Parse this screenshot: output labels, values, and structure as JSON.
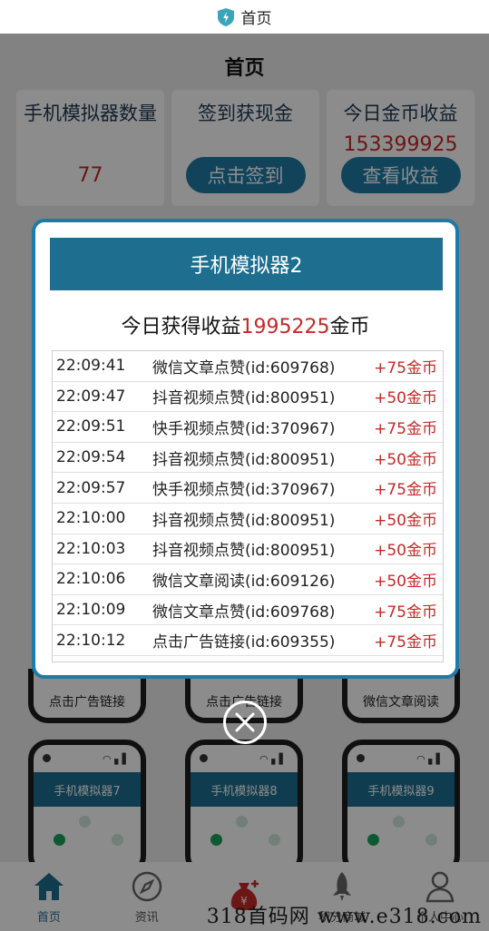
{
  "topbar": {
    "title": "首页"
  },
  "page": {
    "title": "首页"
  },
  "stats": {
    "devices": {
      "label": "手机模拟器数量",
      "value": "77"
    },
    "signin": {
      "label": "签到获现金",
      "button": "点击签到"
    },
    "income": {
      "label": "今日金币收益",
      "value": "153399925",
      "button": "查看收益"
    }
  },
  "bg_cards": {
    "row1": [
      "点击广告链接",
      "点击广告链接",
      "微信文章阅读"
    ],
    "row2": [
      "手机模拟器7",
      "手机模拟器8",
      "手机模拟器9"
    ]
  },
  "modal": {
    "title": "手机模拟器2",
    "summary_prefix": "今日获得收益",
    "summary_amount": "1995225",
    "summary_suffix": "金币",
    "log": [
      {
        "time": "22:09:41",
        "desc": "微信文章点赞(id:609768)",
        "reward": "+75金币"
      },
      {
        "time": "22:09:47",
        "desc": "抖音视频点赞(id:800951)",
        "reward": "+50金币"
      },
      {
        "time": "22:09:51",
        "desc": "快手视频点赞(id:370967)",
        "reward": "+75金币"
      },
      {
        "time": "22:09:54",
        "desc": "抖音视频点赞(id:800951)",
        "reward": "+50金币"
      },
      {
        "time": "22:09:57",
        "desc": "快手视频点赞(id:370967)",
        "reward": "+75金币"
      },
      {
        "time": "22:10:00",
        "desc": "抖音视频点赞(id:800951)",
        "reward": "+50金币"
      },
      {
        "time": "22:10:03",
        "desc": "抖音视频点赞(id:800951)",
        "reward": "+50金币"
      },
      {
        "time": "22:10:06",
        "desc": "微信文章阅读(id:609126)",
        "reward": "+50金币"
      },
      {
        "time": "22:10:09",
        "desc": "微信文章点赞(id:609768)",
        "reward": "+75金币"
      },
      {
        "time": "22:10:12",
        "desc": "点击广告链接(id:609355)",
        "reward": "+75金币"
      }
    ]
  },
  "nav": {
    "items": [
      {
        "label": "首页",
        "icon": "home-icon"
      },
      {
        "label": "资讯",
        "icon": "compass-icon"
      },
      {
        "label": "",
        "icon": "money-bag-icon"
      },
      {
        "label": "积分商城",
        "icon": "rocket-icon"
      },
      {
        "label": "个人中心",
        "icon": "user-icon"
      }
    ]
  },
  "watermark": "318首码网 www.e318.com",
  "colors": {
    "accent": "#1d6e8f",
    "button": "#1f7aa6",
    "amount": "#c62828"
  }
}
